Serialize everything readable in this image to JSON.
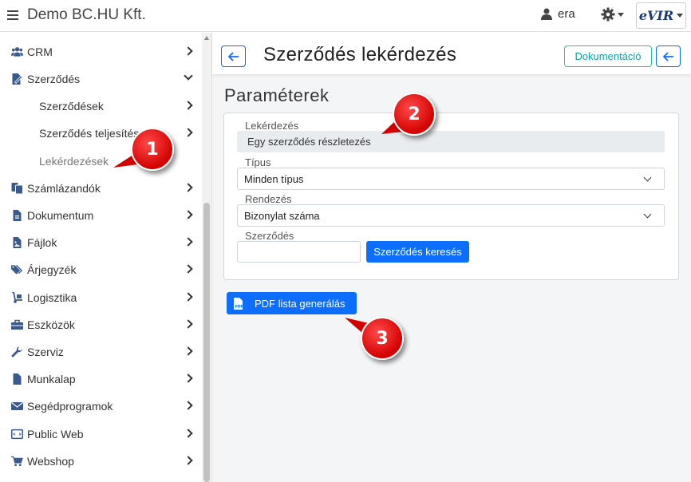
{
  "topbar": {
    "company": "Demo BC.HU Kft.",
    "user": "era",
    "logo_text": "eVIR"
  },
  "sidebar": {
    "items": [
      {
        "label": "CRM",
        "icon": "users-icon"
      },
      {
        "label": "Szerződés",
        "icon": "contract-icon",
        "expanded": true
      },
      {
        "label": "Szerződések",
        "sub": true
      },
      {
        "label": "Szerződés teljesítés",
        "sub": true
      },
      {
        "label": "Lekérdezések",
        "sub": true,
        "active": true
      },
      {
        "label": "Számlázandók",
        "icon": "invoice-icon"
      },
      {
        "label": "Dokumentum",
        "icon": "document-icon"
      },
      {
        "label": "Fájlok",
        "icon": "file-image-icon"
      },
      {
        "label": "Árjegyzék",
        "icon": "tags-icon"
      },
      {
        "label": "Logisztika",
        "icon": "dolly-icon"
      },
      {
        "label": "Eszközök",
        "icon": "toolbox-icon"
      },
      {
        "label": "Szerviz",
        "icon": "wrench-icon"
      },
      {
        "label": "Munkalap",
        "icon": "worksheet-icon"
      },
      {
        "label": "Segédprogramok",
        "icon": "envelope-icon"
      },
      {
        "label": "Public Web",
        "icon": "web-icon"
      },
      {
        "label": "Webshop",
        "icon": "cart-icon"
      }
    ]
  },
  "header": {
    "title": "Szerződés lekérdezés",
    "doc_button": "Dokumentáció"
  },
  "params": {
    "section_title": "Paraméterek",
    "query_label": "Lekérdezés",
    "query_value": "Egy szerződés részletezés",
    "type_label": "Típus",
    "type_value": "Minden típus",
    "sort_label": "Rendezés",
    "sort_value": "Bizonylat száma",
    "contract_label": "Szerződés",
    "contract_value": "",
    "search_button": "Szerződés keresés"
  },
  "actions": {
    "pdf_button": "PDF lista generálás"
  },
  "badges": [
    "1",
    "2",
    "3"
  ],
  "colors": {
    "primary": "#0d6efd",
    "doc_button": "#20c997",
    "badge": "#d40000"
  }
}
